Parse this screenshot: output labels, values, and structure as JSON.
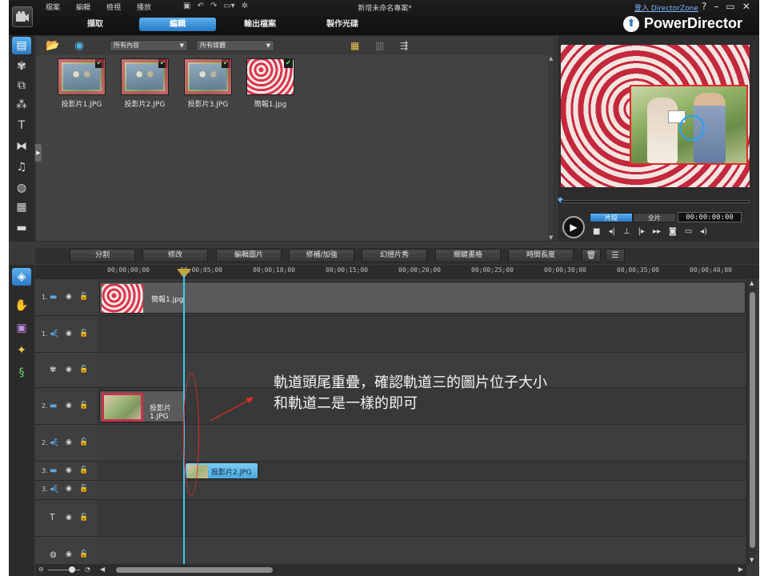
{
  "menu": [
    "檔案",
    "編輯",
    "檢視",
    "播放"
  ],
  "project_title": "新增未命名專案*",
  "login_link": "登入 DirectorZone",
  "window_controls": {
    "help": "?",
    "minimize": "–",
    "restore": "▭",
    "close": "✕"
  },
  "mode_tabs": [
    {
      "label": "擷取",
      "active": false
    },
    {
      "label": "編輯",
      "active": true
    },
    {
      "label": "輸出檔案",
      "active": false
    },
    {
      "label": "製作光碟",
      "active": false
    }
  ],
  "brand": {
    "name": "PowerDirector"
  },
  "library": {
    "filter_content": "所有內容",
    "filter_media": "所有媒體",
    "items": [
      {
        "label": "投影片1.JPG",
        "used": true,
        "kind": "photo"
      },
      {
        "label": "投影片2.JPG",
        "used": true,
        "kind": "photo"
      },
      {
        "label": "投影片3.JPG",
        "used": true,
        "kind": "photo"
      },
      {
        "label": "簡報1.jpg",
        "used": true,
        "kind": "hearts"
      }
    ]
  },
  "preview": {
    "mode_clip": "片段",
    "mode_movie": "全片",
    "timecode": "00:00:00:00"
  },
  "edit_toolbar": [
    "分割",
    "修改",
    "編輯圖片",
    "修補/加強",
    "幻燈片秀",
    "關鍵畫格",
    "時間長度"
  ],
  "ruler": [
    "00;00;00;00",
    "00;00;05;00",
    "00;00;10;00",
    "00;00;15;00",
    "00;00;20;00",
    "00;00;25;00",
    "00;00;30;00",
    "00;00;35;00",
    "00;00;40;00"
  ],
  "tracks": [
    {
      "num": "1.",
      "type": "video"
    },
    {
      "num": "1.",
      "type": "audio"
    },
    {
      "num": "",
      "type": "fx"
    },
    {
      "num": "2.",
      "type": "video"
    },
    {
      "num": "2.",
      "type": "audio"
    },
    {
      "num": "3.",
      "type": "video"
    },
    {
      "num": "3.",
      "type": "audio"
    },
    {
      "num": "",
      "type": "title"
    },
    {
      "num": "",
      "type": "voice"
    }
  ],
  "clips": {
    "track1": "簡報1.jpg",
    "track2": "投影片1.JPG",
    "track3": "投影片2.JPG"
  },
  "annotation": {
    "line1": "軌道頭尾重疊，確認軌道三的圖片位子大小",
    "line2": "和軌道二是一樣的即可"
  },
  "colors": {
    "accent": "#2a7ac4",
    "playhead": "#3ec8f0",
    "annotation": "#e02a2a"
  }
}
